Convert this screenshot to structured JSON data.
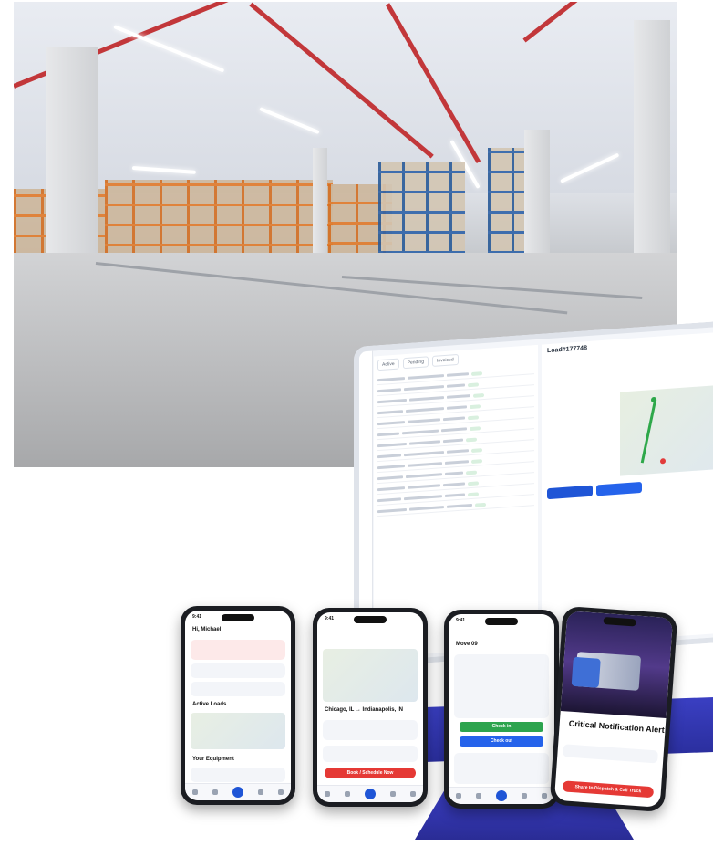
{
  "dashboard": {
    "load_id": "Load#177748",
    "tabs": [
      "Active",
      "Pending",
      "Invoiced"
    ],
    "brand_color": "#1f55d6"
  },
  "phone1": {
    "time": "9:41",
    "greeting": "Hi, Michael",
    "section_active": "Active Loads",
    "section_equipment": "Your Equipment"
  },
  "phone2": {
    "time": "9:41",
    "route": "Chicago, IL → Indianapolis, IN",
    "cta": "Book / Schedule Now"
  },
  "phone3": {
    "time": "9:41",
    "stop_label": "Move 09",
    "checkin": "Check in",
    "checkout": "Check out"
  },
  "phone4": {
    "time": "9:41",
    "alert_title": "Critical Notification Alert",
    "cta": "Share to Dispatch & Call Truck"
  },
  "colors": {
    "accent": "#1f55d6",
    "danger": "#e53935",
    "success": "#2da44e",
    "device": "#2f33ad"
  }
}
